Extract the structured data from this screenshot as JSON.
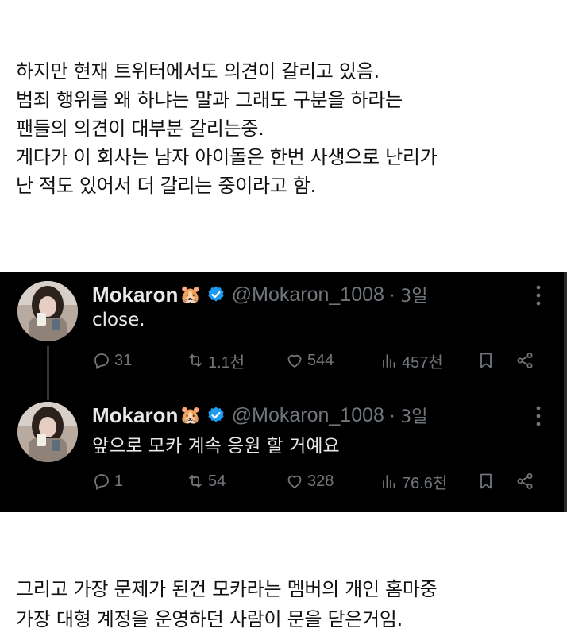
{
  "intro": {
    "lines": [
      "하지만 현재 트위터에서도 의견이 갈리고 있음.",
      "범죄 행위를 왜 하냐는 말과 그래도 구분을 하라는",
      "팬들의 의견이 대부분 갈리는중.",
      "게다가 이 회사는 남자 아이돌은 한번 사생으로 난리가",
      "난 적도 있어서 더 갈리는 중이라고 함."
    ]
  },
  "tweets": [
    {
      "name": "Mokaron",
      "emoji": "🐹",
      "handle": "@Mokaron_1008",
      "separator": "·",
      "time": "3일",
      "text": "close.",
      "replies": "31",
      "retweets": "1.1천",
      "likes": "544",
      "views": "457천"
    },
    {
      "name": "Mokaron",
      "emoji": "🐹",
      "handle": "@Mokaron_1008",
      "separator": "·",
      "time": "3일",
      "text": "앞으로 모카 계속 응원 할 거예요",
      "replies": "1",
      "retweets": "54",
      "likes": "328",
      "views": "76.6천"
    }
  ],
  "outro": {
    "lines": [
      "그리고 가장 문제가 된건 모카라는 멤버의 개인 홈마중",
      "가장 대형 계정을 운영하던 사람이 문을 닫은거임."
    ]
  },
  "colors": {
    "background": "#ffffff",
    "panel": "#000000",
    "primary_text": "#e7e9ea",
    "secondary_text": "#71767b",
    "verified": "#1d9bf0"
  },
  "icons": [
    "reply-icon",
    "retweet-icon",
    "like-icon",
    "views-icon",
    "bookmark-icon",
    "share-icon",
    "more-icon",
    "verified-badge-icon",
    "hamster-emoji"
  ]
}
